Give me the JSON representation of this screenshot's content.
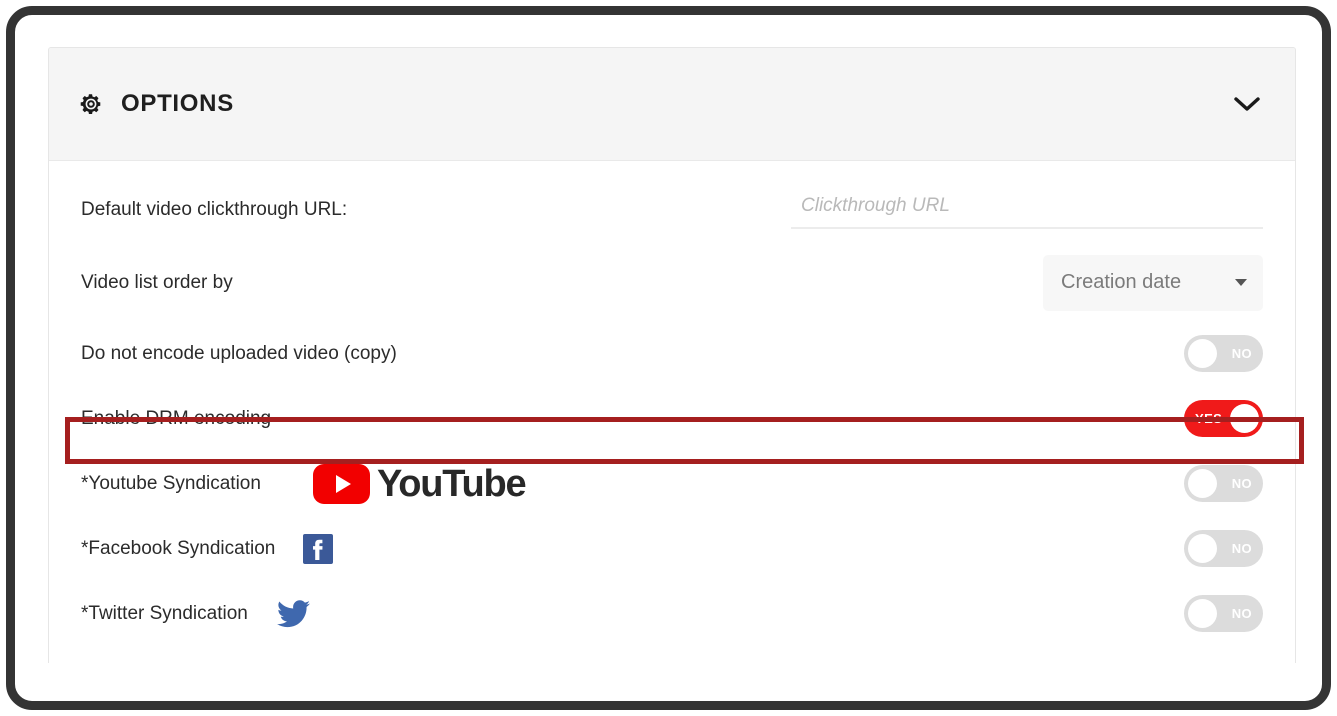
{
  "window": {
    "frame_color": "#343434",
    "page_background": "#ffffff"
  },
  "card": {
    "header": {
      "icon": "gear-icon",
      "title": "OPTIONS",
      "collapse_icon": "chevron-down-icon",
      "background": "#f5f5f5"
    }
  },
  "rows": {
    "clickthrough": {
      "label": "Default video clickthrough URL:",
      "input_value": "",
      "input_placeholder": "Clickthrough URL"
    },
    "order_by": {
      "label": "Video list order by",
      "selected": "Creation date",
      "caret_icon": "chevron-down-icon"
    },
    "no_encode": {
      "label": "Do not encode uploaded video (copy)",
      "toggle_state": "NO"
    },
    "drm": {
      "label": "Enable DRM encoding",
      "toggle_state": "YES",
      "highlighted": true,
      "highlight_color": "#a51f1f",
      "toggle_on_color": "#f01a1a"
    },
    "youtube": {
      "label": "*Youtube Syndication",
      "logo": "youtube-logo",
      "logo_wordmark": "YouTube",
      "logo_color": "#f20000",
      "toggle_state": "NO"
    },
    "facebook": {
      "label": "*Facebook Syndication",
      "logo": "facebook-logo",
      "logo_color": "#3b5998",
      "toggle_state": "NO"
    },
    "twitter": {
      "label": "*Twitter Syndication",
      "logo": "twitter-logo",
      "logo_color": "#3f68ae",
      "toggle_state": "NO"
    }
  }
}
